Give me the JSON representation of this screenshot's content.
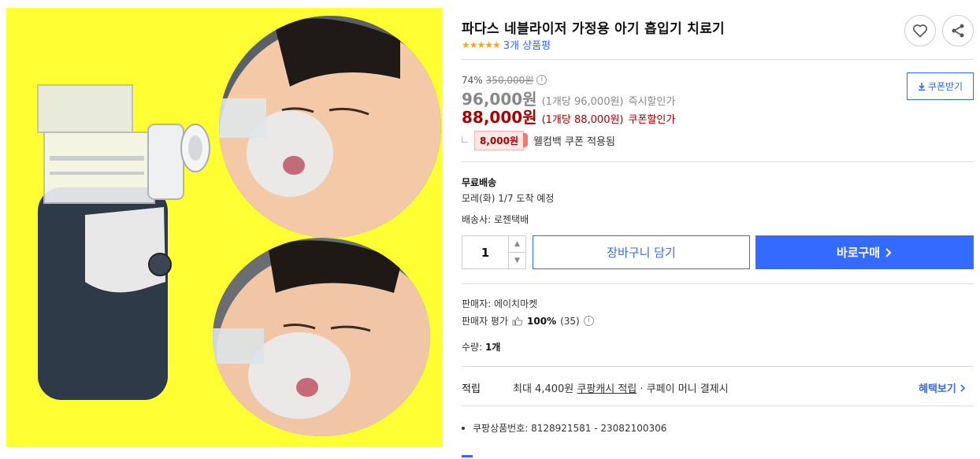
{
  "product": {
    "title": "파다스 네블라이저 가정용 아기 흡입기 치료기",
    "stars": "★★★★★",
    "review_count": "3개 상품평",
    "rating_value": 5
  },
  "pricing": {
    "discount_rate": "74%",
    "original_price": "350,000원",
    "sale_price": "96,000원",
    "sale_unit": "(1개당 96,000원)",
    "sale_label": "즉시할인가",
    "coupon_price": "88,000원",
    "coupon_unit": "(1개당 88,000원)",
    "coupon_label": "쿠폰할인가",
    "coupon_button": "쿠폰받기",
    "cashback_amount": "8,000원",
    "cashback_text": "웰컴백 쿠폰 적용됨"
  },
  "shipping": {
    "title": "무료배송",
    "arrival": "모레(화) 1/7 도착 예정",
    "carrier": "배송사: 로젠택배"
  },
  "purchase": {
    "quantity": "1",
    "cart_label": "장바구니 담기",
    "buy_label": "바로구매"
  },
  "seller": {
    "name": "판매자: 에이치마켓",
    "rating_label": "판매자 평가",
    "rating_percent": "100%",
    "rating_count": "(35)",
    "quantity_label": "수량:",
    "quantity_value": "1개"
  },
  "points": {
    "label": "적립",
    "text_prefix": "최대 4,400원",
    "text_link": "쿠팡캐시 적립",
    "text_suffix": "· 쿠페이 머니 결제시",
    "benefit_link": "혜택보기"
  },
  "meta": {
    "product_number": "쿠팡상품번호: 8128921581 - 23082100306"
  },
  "colors": {
    "accent": "#346aff",
    "coupon_red": "#ae0000",
    "star": "#f6a823",
    "image_bg": "#ffff33"
  }
}
